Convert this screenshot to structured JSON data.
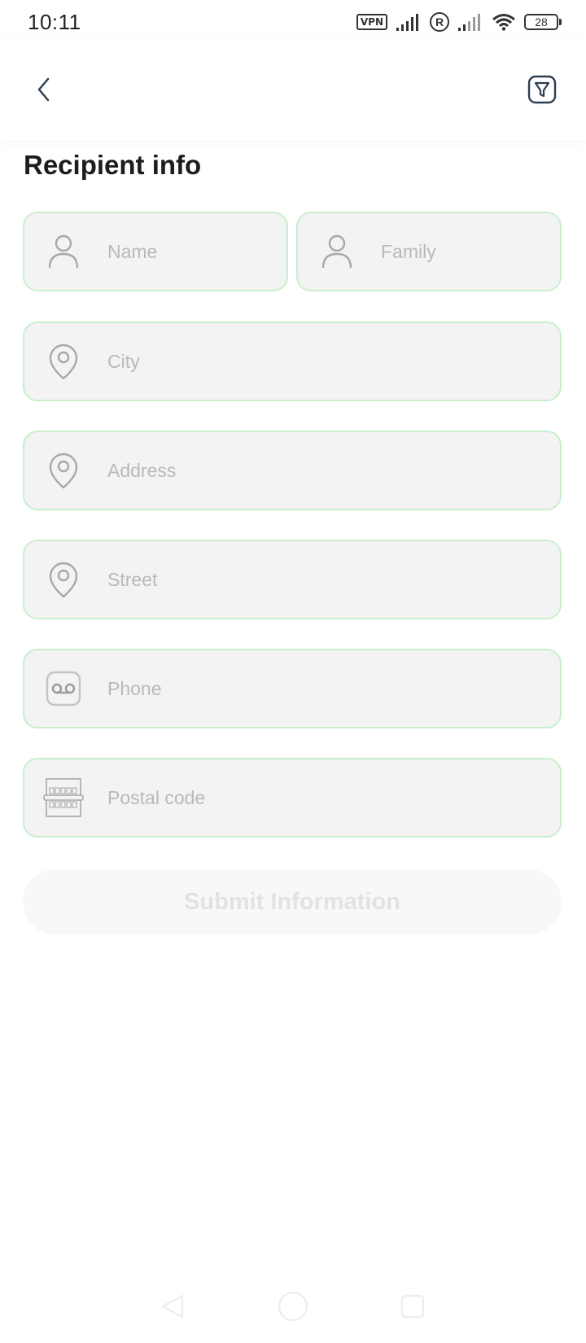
{
  "status_bar": {
    "time": "10:11",
    "vpn_label": "VPN",
    "roaming_label": "R",
    "battery": "28"
  },
  "header": {
    "back_icon": "chevron-left-icon",
    "action_icon": "filter-icon"
  },
  "page": {
    "title": "Recipient info"
  },
  "form": {
    "name": {
      "placeholder": "Name",
      "value": "",
      "icon": "person-icon"
    },
    "family": {
      "placeholder": "Family",
      "value": "",
      "icon": "person-icon"
    },
    "city": {
      "placeholder": "City",
      "value": "",
      "icon": "location-pin-icon"
    },
    "address": {
      "placeholder": "Address",
      "value": "",
      "icon": "location-pin-icon"
    },
    "street": {
      "placeholder": "Street",
      "value": "",
      "icon": "location-pin-icon"
    },
    "phone": {
      "placeholder": "Phone",
      "value": "",
      "icon": "voicemail-icon"
    },
    "postal_code": {
      "placeholder": "Postal code",
      "value": "",
      "icon": "postal-box-icon"
    }
  },
  "submit": {
    "label": "Submit Information",
    "enabled": false
  },
  "colors": {
    "field_border": "#c8efcd",
    "field_background": "#f3f3f3",
    "placeholder": "#b9b9b9",
    "submit_text_disabled": "#e2e2e2"
  }
}
